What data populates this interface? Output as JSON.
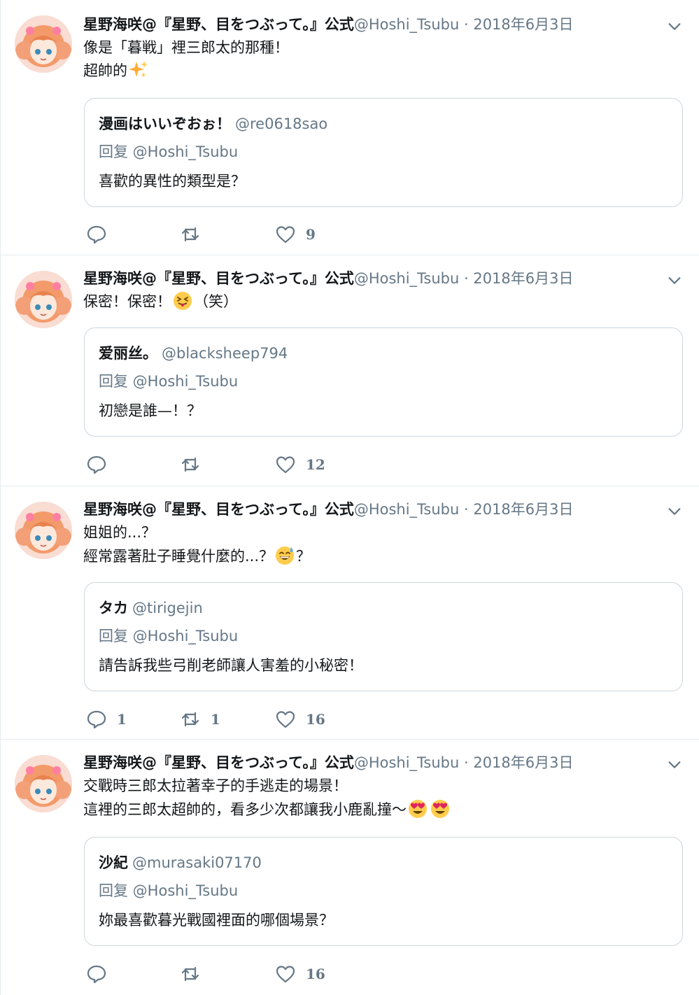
{
  "tweets": [
    {
      "name": "星野海咲@『星野、目をつぶって。』公式",
      "handle": "@Hoshi_Tsubu",
      "sep": " · ",
      "date": "2018年6月3日",
      "lines": [
        "像是「暮戦」裡三郎太的那種！",
        "超帥的"
      ],
      "quote": {
        "name": "漫画はいいぞおぉ！",
        "handle": "@re0618sao",
        "reply": "回复 @Hoshi_Tsubu",
        "text": "喜歡的異性的類型是？"
      },
      "replies": "",
      "retweets": "",
      "likes": "9"
    },
    {
      "name": "星野海咲@『星野、目をつぶって。』公式",
      "handle": "@Hoshi_Tsubu",
      "sep": " · ",
      "date": "2018年6月3日",
      "lines": [
        "保密！保密！",
        "（笑）"
      ],
      "quote": {
        "name": "爱丽丝。",
        "handle": "@blacksheep794",
        "reply": "回复 @Hoshi_Tsubu",
        "text": "初戀是誰—！？"
      },
      "replies": "",
      "retweets": "",
      "likes": "12"
    },
    {
      "name": "星野海咲@『星野、目をつぶって。』公式",
      "handle": "@Hoshi_Tsubu",
      "sep": " · ",
      "date": "2018年6月3日",
      "lines": [
        "姐姐的...？",
        "經常露著肚子睡覺什麼的...？",
        "？"
      ],
      "quote": {
        "name": "タカ",
        "handle": "@tirigejin",
        "reply": "回复 @Hoshi_Tsubu",
        "text": "請告訴我些弓削老師讓人害羞的小秘密！"
      },
      "replies": "1",
      "retweets": "1",
      "likes": "16"
    },
    {
      "name": "星野海咲@『星野、目をつぶって。』公式",
      "handle": "@Hoshi_Tsubu",
      "sep": " · ",
      "date": "2018年6月3日",
      "lines": [
        "交戰時三郎太拉著幸子的手逃走的場景！",
        "這裡的三郎太超帥的，看多少次都讓我小鹿亂撞〜"
      ],
      "quote": {
        "name": "沙紀",
        "handle": "@murasaki07170",
        "reply": "回复 @Hoshi_Tsubu",
        "text": "妳最喜歡暮光戰國裡面的哪個場景？"
      },
      "replies": "",
      "retweets": "",
      "likes": "16"
    }
  ],
  "icons": {
    "avatar": "anime-girl-avatar",
    "caret": "chevron-down-icon",
    "reply": "reply-bubble-icon",
    "retweet": "retweet-icon",
    "like": "heart-icon",
    "sparkles": "sparkles-emoji",
    "tongue": "squinting-tongue-emoji",
    "sweat": "grinning-sweat-emoji",
    "heart_eyes": "heart-eyes-emoji"
  },
  "colors": {
    "text": "#14171a",
    "secondary": "#657786",
    "border": "#ccd6dd",
    "divider": "#e6ecf0",
    "emoji_yellow": "#ffcc4d",
    "heart_red": "#e0245e"
  }
}
